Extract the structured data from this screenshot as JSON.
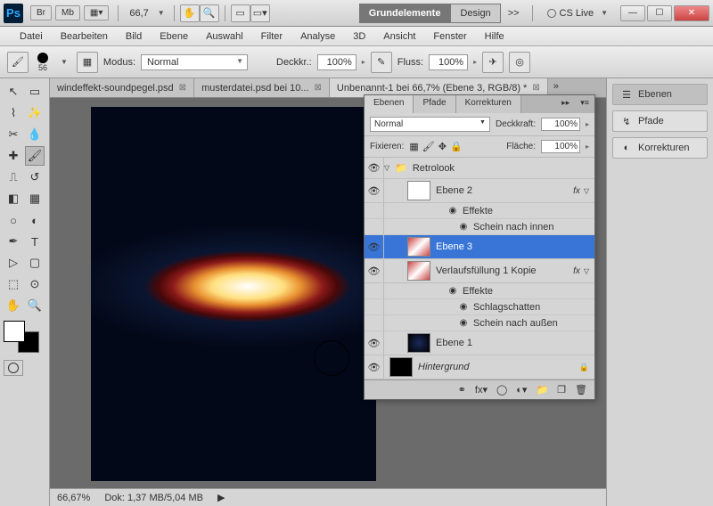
{
  "title_bar": {
    "ps": "Ps",
    "br": "Br",
    "mb": "Mb",
    "zoom": "66,7",
    "workspace_sel": "Grundelemente",
    "workspace_alt": "Design",
    "more": ">>",
    "cslive": "CS Live"
  },
  "menu": [
    "Datei",
    "Bearbeiten",
    "Bild",
    "Ebene",
    "Auswahl",
    "Filter",
    "Analyse",
    "3D",
    "Ansicht",
    "Fenster",
    "Hilfe"
  ],
  "options": {
    "brush_size": "56",
    "mode_label": "Modus:",
    "mode_value": "Normal",
    "opacity_label": "Deckkr.:",
    "opacity_value": "100%",
    "flow_label": "Fluss:",
    "flow_value": "100%"
  },
  "tabs": [
    {
      "label": "windeffekt-soundpegel.psd",
      "active": false
    },
    {
      "label": "musterdatei.psd bei 10...",
      "active": false
    },
    {
      "label": "Unbenannt-1 bei 66,7% (Ebene 3, RGB/8) *",
      "active": true
    }
  ],
  "status": {
    "zoom": "66,67%",
    "doc": "Dok: 1,37 MB/5,04 MB"
  },
  "right_panels": [
    {
      "label": "Ebenen",
      "active": true,
      "name": "layers"
    },
    {
      "label": "Pfade",
      "active": false,
      "name": "paths"
    },
    {
      "label": "Korrekturen",
      "active": false,
      "name": "adjustments"
    }
  ],
  "layers_panel": {
    "tabs": [
      "Ebenen",
      "Pfade",
      "Korrekturen"
    ],
    "blend": "Normal",
    "opacity_label": "Deckkraft:",
    "opacity": "100%",
    "lock_label": "Fixieren:",
    "fill_label": "Fläche:",
    "fill": "100%",
    "group": "Retrolook",
    "layers": {
      "ebene2": "Ebene 2",
      "effekte": "Effekte",
      "innerglow": "Schein nach innen",
      "ebene3": "Ebene 3",
      "gradient": "Verlaufsfüllung 1 Kopie",
      "dropshadow": "Schlagschatten",
      "outerglow": "Schein nach außen",
      "ebene1": "Ebene 1",
      "background": "Hintergrund"
    }
  }
}
